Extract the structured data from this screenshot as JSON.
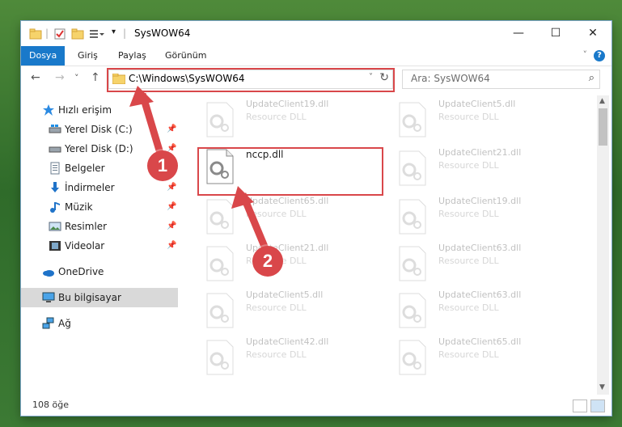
{
  "window": {
    "title": "SysWOW64",
    "minimize": "—",
    "maximize": "☐",
    "close": "✕"
  },
  "ribbon": {
    "tabs": [
      "Dosya",
      "Giriş",
      "Paylaş",
      "Görünüm"
    ],
    "active_tab": "Dosya",
    "help": "?"
  },
  "navigation": {
    "back": "←",
    "forward": "→",
    "recent": "˅",
    "up": "↑",
    "address": "C:\\Windows\\SysWOW64",
    "refresh": "↻",
    "search_placeholder": "Ara: SysWOW64"
  },
  "sidebar": {
    "items": [
      {
        "label": "Hızlı erişim",
        "icon": "star-icon",
        "pinned": false
      },
      {
        "label": "Yerel Disk (C:)",
        "icon": "drive-icon",
        "pinned": true
      },
      {
        "label": "Yerel Disk (D:)",
        "icon": "drive-icon",
        "pinned": true
      },
      {
        "label": "Belgeler",
        "icon": "documents-icon",
        "pinned": true
      },
      {
        "label": "İndirmeler",
        "icon": "download-icon",
        "pinned": true
      },
      {
        "label": "Müzik",
        "icon": "music-icon",
        "pinned": true
      },
      {
        "label": "Resimler",
        "icon": "pictures-icon",
        "pinned": true
      },
      {
        "label": "Videolar",
        "icon": "videos-icon",
        "pinned": true
      },
      {
        "label": "OneDrive",
        "icon": "cloud-icon",
        "pinned": false
      },
      {
        "label": "Bu bilgisayar",
        "icon": "computer-icon",
        "pinned": false,
        "selected": true
      },
      {
        "label": "Ağ",
        "icon": "network-icon",
        "pinned": false
      }
    ]
  },
  "files": {
    "left": [
      {
        "name": "UpdateClient19.dll",
        "type": "Resource DLL",
        "faded": true
      },
      {
        "name": "nccp.dll",
        "type": "",
        "faded": false,
        "highlighted": true
      },
      {
        "name": "UpdateClient65.dll",
        "type": "Resource DLL",
        "faded": true
      },
      {
        "name": "UpdateClient21.dll",
        "type": "Resource DLL",
        "faded": true
      },
      {
        "name": "UpdateClient5.dll",
        "type": "Resource DLL",
        "faded": true
      },
      {
        "name": "UpdateClient42.dll",
        "type": "Resource DLL",
        "faded": true
      }
    ],
    "right": [
      {
        "name": "UpdateClient5.dll",
        "type": "Resource DLL",
        "faded": true
      },
      {
        "name": "UpdateClient21.dll",
        "type": "Resource DLL",
        "faded": true
      },
      {
        "name": "UpdateClient19.dll",
        "type": "Resource DLL",
        "faded": true
      },
      {
        "name": "UpdateClient63.dll",
        "type": "Resource DLL",
        "faded": true
      },
      {
        "name": "UpdateClient63.dll",
        "type": "Resource DLL",
        "faded": true
      },
      {
        "name": "UpdateClient65.dll",
        "type": "Resource DLL",
        "faded": true
      }
    ]
  },
  "status": {
    "item_count": "108 öğe"
  },
  "annotations": {
    "step1": "1",
    "step2": "2",
    "color": "#d9474a"
  },
  "colors": {
    "accent": "#1979ca",
    "highlight": "#d9474a"
  }
}
